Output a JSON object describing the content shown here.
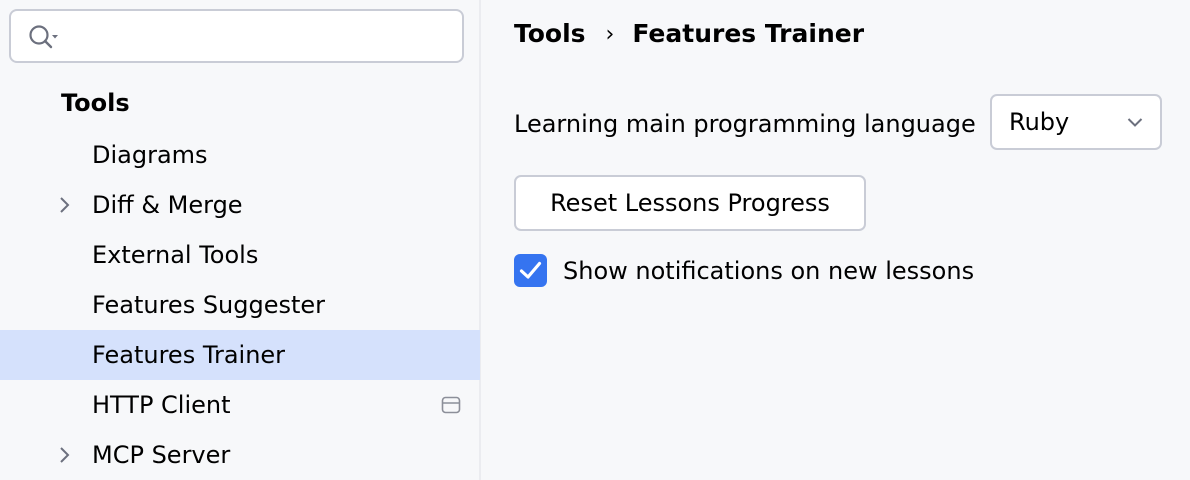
{
  "search": {
    "value": "",
    "placeholder": "",
    "icon": "search-icon"
  },
  "sidebar": {
    "section_title": "Tools",
    "items": [
      {
        "label": "Diagrams",
        "expandable": false
      },
      {
        "label": "Diff & Merge",
        "expandable": true
      },
      {
        "label": "External Tools",
        "expandable": false
      },
      {
        "label": "Features Suggester",
        "expandable": false
      },
      {
        "label": "Features Trainer",
        "expandable": false,
        "selected": true
      },
      {
        "label": "HTTP Client",
        "expandable": false,
        "badge_icon": "window-icon"
      },
      {
        "label": "MCP Server",
        "expandable": true
      }
    ]
  },
  "breadcrumb": {
    "parent": "Tools",
    "separator": "›",
    "current": "Features Trainer"
  },
  "settings": {
    "language_label": "Learning main programming language",
    "language_value": "Ruby",
    "reset_button": "Reset Lessons Progress",
    "notifications_label": "Show notifications on new lessons",
    "notifications_checked": true
  },
  "colors": {
    "background": "#f7f8fa",
    "selected_row": "#d5e1fc",
    "accent": "#3574f0",
    "border": "#c9ccd6"
  }
}
